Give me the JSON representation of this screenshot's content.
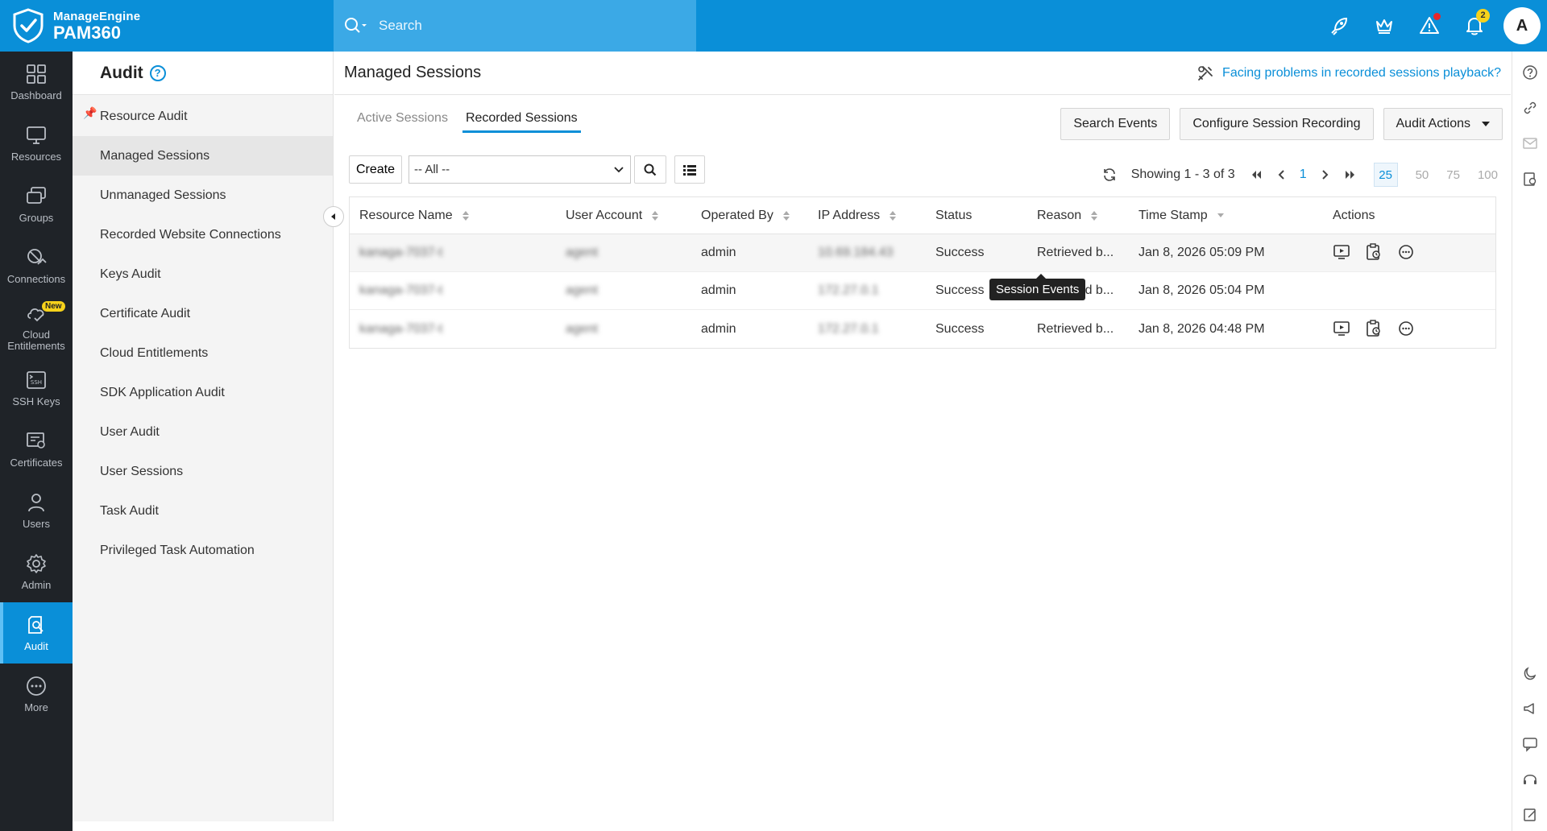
{
  "brand": {
    "top": "ManageEngine",
    "product": "PAM360"
  },
  "search": {
    "placeholder": "Search"
  },
  "notifications": {
    "count": "2"
  },
  "user": {
    "initial": "A"
  },
  "leftnav": [
    {
      "label": "Dashboard",
      "icon": "dashboard-icon"
    },
    {
      "label": "Resources",
      "icon": "monitor-icon"
    },
    {
      "label": "Groups",
      "icon": "groups-icon"
    },
    {
      "label": "Connections",
      "icon": "connections-icon"
    },
    {
      "label": "Cloud Entitlements",
      "icon": "cloud-icon",
      "tag": "New"
    },
    {
      "label": "SSH Keys",
      "icon": "ssh-icon"
    },
    {
      "label": "Certificates",
      "icon": "certificate-icon"
    },
    {
      "label": "Users",
      "icon": "user-icon"
    },
    {
      "label": "Admin",
      "icon": "gear-icon"
    },
    {
      "label": "Audit",
      "icon": "audit-icon",
      "active": true
    },
    {
      "label": "More",
      "icon": "more-icon"
    }
  ],
  "subnav": {
    "title": "Audit",
    "items": [
      {
        "label": "Resource Audit",
        "pinned": true
      },
      {
        "label": "Managed Sessions",
        "active": true
      },
      {
        "label": "Unmanaged Sessions"
      },
      {
        "label": "Recorded Website Connections"
      },
      {
        "label": "Keys Audit"
      },
      {
        "label": "Certificate Audit"
      },
      {
        "label": "Cloud Entitlements"
      },
      {
        "label": "SDK Application Audit"
      },
      {
        "label": "User Audit"
      },
      {
        "label": "User Sessions"
      },
      {
        "label": "Task Audit"
      },
      {
        "label": "Privileged Task Automation"
      }
    ]
  },
  "main": {
    "title": "Managed Sessions",
    "help_link": "Facing problems in recorded sessions playback?",
    "tabs": [
      {
        "label": "Active Sessions"
      },
      {
        "label": "Recorded Sessions",
        "active": true
      }
    ],
    "buttons": {
      "search_events": "Search Events",
      "configure": "Configure Session Recording",
      "audit_actions": "Audit Actions"
    },
    "toolbar": {
      "create": "Create",
      "filter_value": "-- All --"
    },
    "pager": {
      "showing": "Showing 1 - 3 of 3",
      "page": "1",
      "sizes": [
        "25",
        "50",
        "75",
        "100"
      ],
      "selected_size": "25"
    },
    "table": {
      "columns": [
        "Resource Name",
        "User Account",
        "Operated By",
        "IP Address",
        "Status",
        "Reason",
        "Time Stamp",
        "Actions"
      ],
      "rows": [
        {
          "resource": "kanaga-7037-t",
          "account": "agent",
          "operated_by": "admin",
          "ip": "10.69.184.43",
          "status": "Success",
          "reason": "Retrieved b...",
          "timestamp": "Jan 8, 2026 05:09 PM"
        },
        {
          "resource": "kanaga-7037-t",
          "account": "agent",
          "operated_by": "admin",
          "ip": "172.27.0.1",
          "status": "Success",
          "reason": "Retrieved b...",
          "timestamp": "Jan 8, 2026 05:04 PM"
        },
        {
          "resource": "kanaga-7037-t",
          "account": "agent",
          "operated_by": "admin",
          "ip": "172.27.0.1",
          "status": "Success",
          "reason": "Retrieved b...",
          "timestamp": "Jan 8, 2026 04:48 PM"
        }
      ]
    },
    "tooltip": "Session Events"
  },
  "colors": {
    "primary": "#0a8fd8",
    "nav_bg": "#1f2328",
    "badge": "#f7d21b"
  }
}
